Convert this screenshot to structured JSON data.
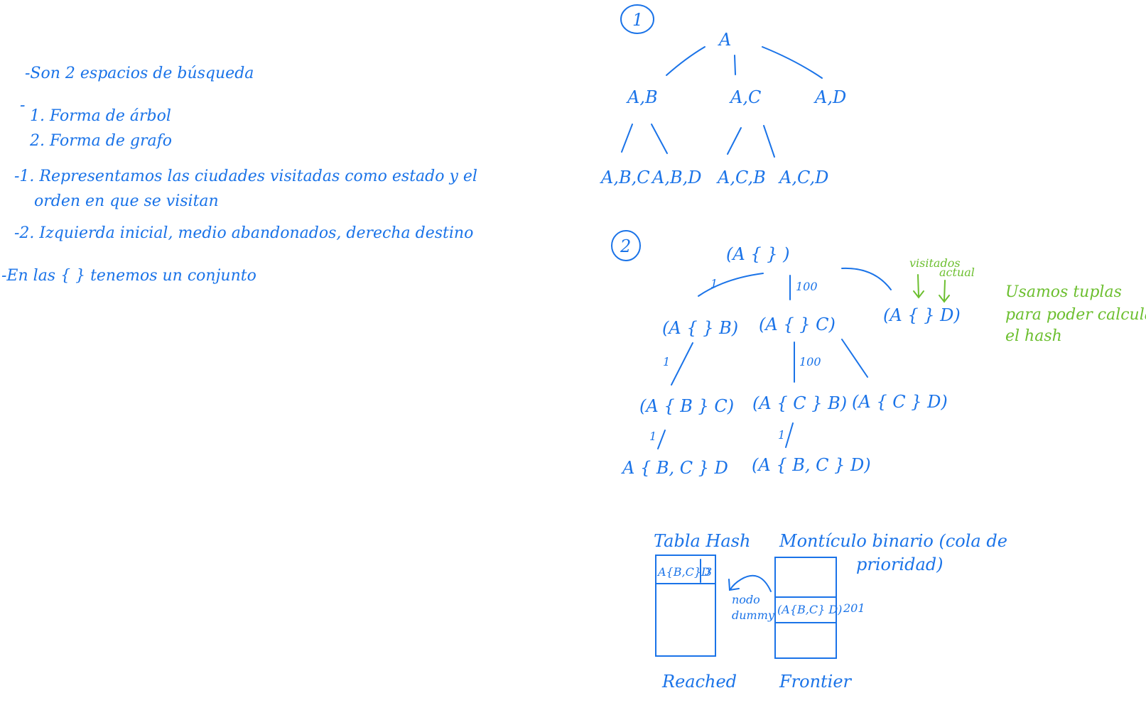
{
  "colors": {
    "ink_blue": "#1a73e8",
    "ink_green": "#6cbf2f",
    "background": "#ffffff"
  },
  "notes": {
    "line1": "-Son 2 espacios de búsqueda",
    "line2_dash": "-",
    "line2": "1. Forma de árbol",
    "line3": "2. Forma de grafo",
    "line4": "-1. Representamos las ciudades visitadas como estado y el",
    "line5": "orden en que se visitan",
    "line6": "-2. Izquierda inicial, medio abandonados, derecha destino",
    "line7": "-En las { } tenemos un conjunto"
  },
  "section1": {
    "marker": "1",
    "root": "A",
    "level1": [
      "A,B",
      "A,C",
      "A,D"
    ],
    "level2": [
      "A,B,C",
      "A,B,D",
      "A,C,B",
      "A,C,D"
    ]
  },
  "section2": {
    "marker": "2",
    "root": "(A { } )",
    "root_edge_weights": [
      "1",
      "100"
    ],
    "level1": [
      "(A { } B)",
      "(A { } C)",
      "(A { } D)"
    ],
    "level1_edge_weights": [
      "1",
      "100"
    ],
    "level2": [
      "(A { B } C)",
      "(A { C } B)",
      "(A { C } D)"
    ],
    "level2_edge_weights": [
      "1",
      "1"
    ],
    "level3": [
      "A { B, C } D",
      "(A { B, C } D)"
    ],
    "annotation_visitados": "visitados",
    "annotation_actual": "actual",
    "side_note_line1": "Usamos tuplas",
    "side_note_line2": "para poder calcular",
    "side_note_line3": "el hash"
  },
  "structures": {
    "hash_title": "Tabla Hash",
    "hash_entry_key": "A{B,C}D",
    "hash_entry_value": "3",
    "hash_label": "Reached",
    "heap_title_line1": "Montículo binario (cola de",
    "heap_title_line2": "prioridad)",
    "heap_entry": "(A{B,C} D)",
    "heap_entry_priority": "201",
    "heap_label": "Frontier",
    "arrow_note_line1": "nodo",
    "arrow_note_line2": "dummy"
  }
}
